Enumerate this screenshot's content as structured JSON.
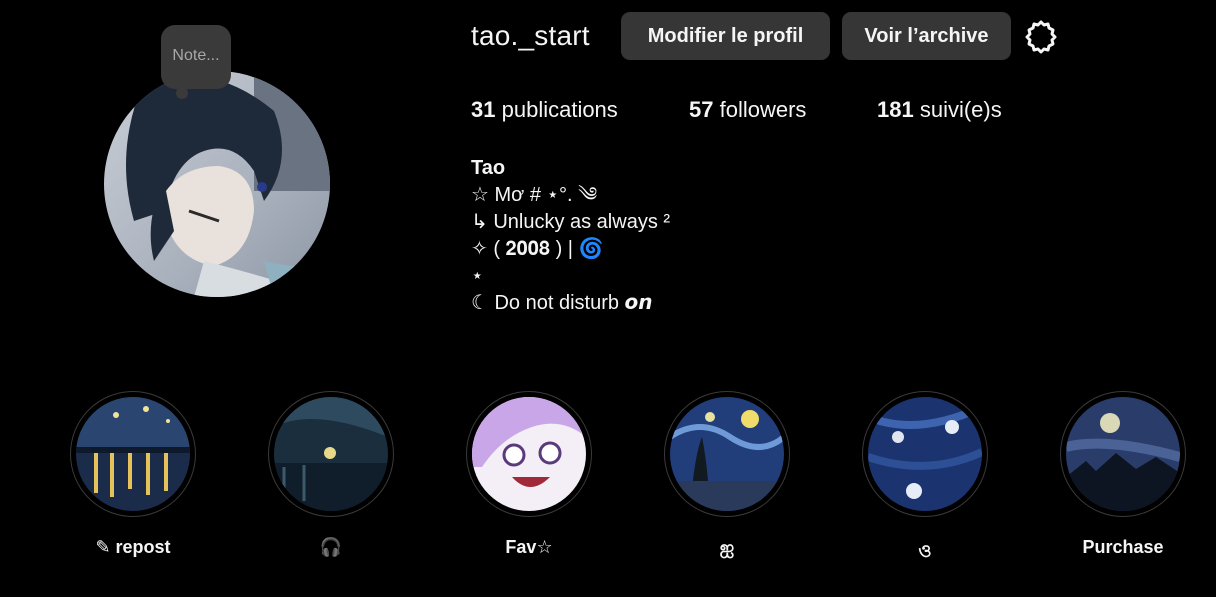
{
  "profile": {
    "username": "tao._start",
    "note_placeholder": "Note...",
    "avatar_icon": "anime-avatar"
  },
  "header": {
    "edit_label": "Modifier le profil",
    "archive_label": "Voir l’archive",
    "settings_icon": "gear-icon"
  },
  "stats": {
    "posts_count": "31",
    "posts_label": "publications",
    "followers_count": "57",
    "followers_label": "followers",
    "following_count": "181",
    "following_label": "suivi(e)s"
  },
  "bio": {
    "name": "Tao",
    "lines": [
      "☆ Mơ # ⋆°. ༄",
      "↳ Unlucky as always ²",
      "✧ ( 𝟐𝟎𝟎𝟖 ) | ",
      "⋆",
      "☾ Do not disturb 𝙤𝙣"
    ],
    "spiral": "🌀"
  },
  "highlights": [
    {
      "label": "✎ repost",
      "theme": "starry-night-rhone"
    },
    {
      "label": "🎧",
      "theme": "night-harbor"
    },
    {
      "label": "Fav☆",
      "theme": "anime-purple-hair"
    },
    {
      "label": "ஐ",
      "theme": "starry-night"
    },
    {
      "label": "ও",
      "theme": "water-lilies"
    },
    {
      "label": "Purchase",
      "theme": "night-moon"
    }
  ],
  "colors": {
    "background": "#000000",
    "button": "#363636",
    "text": "#f5f5f5",
    "muted": "#a8a8a8"
  }
}
